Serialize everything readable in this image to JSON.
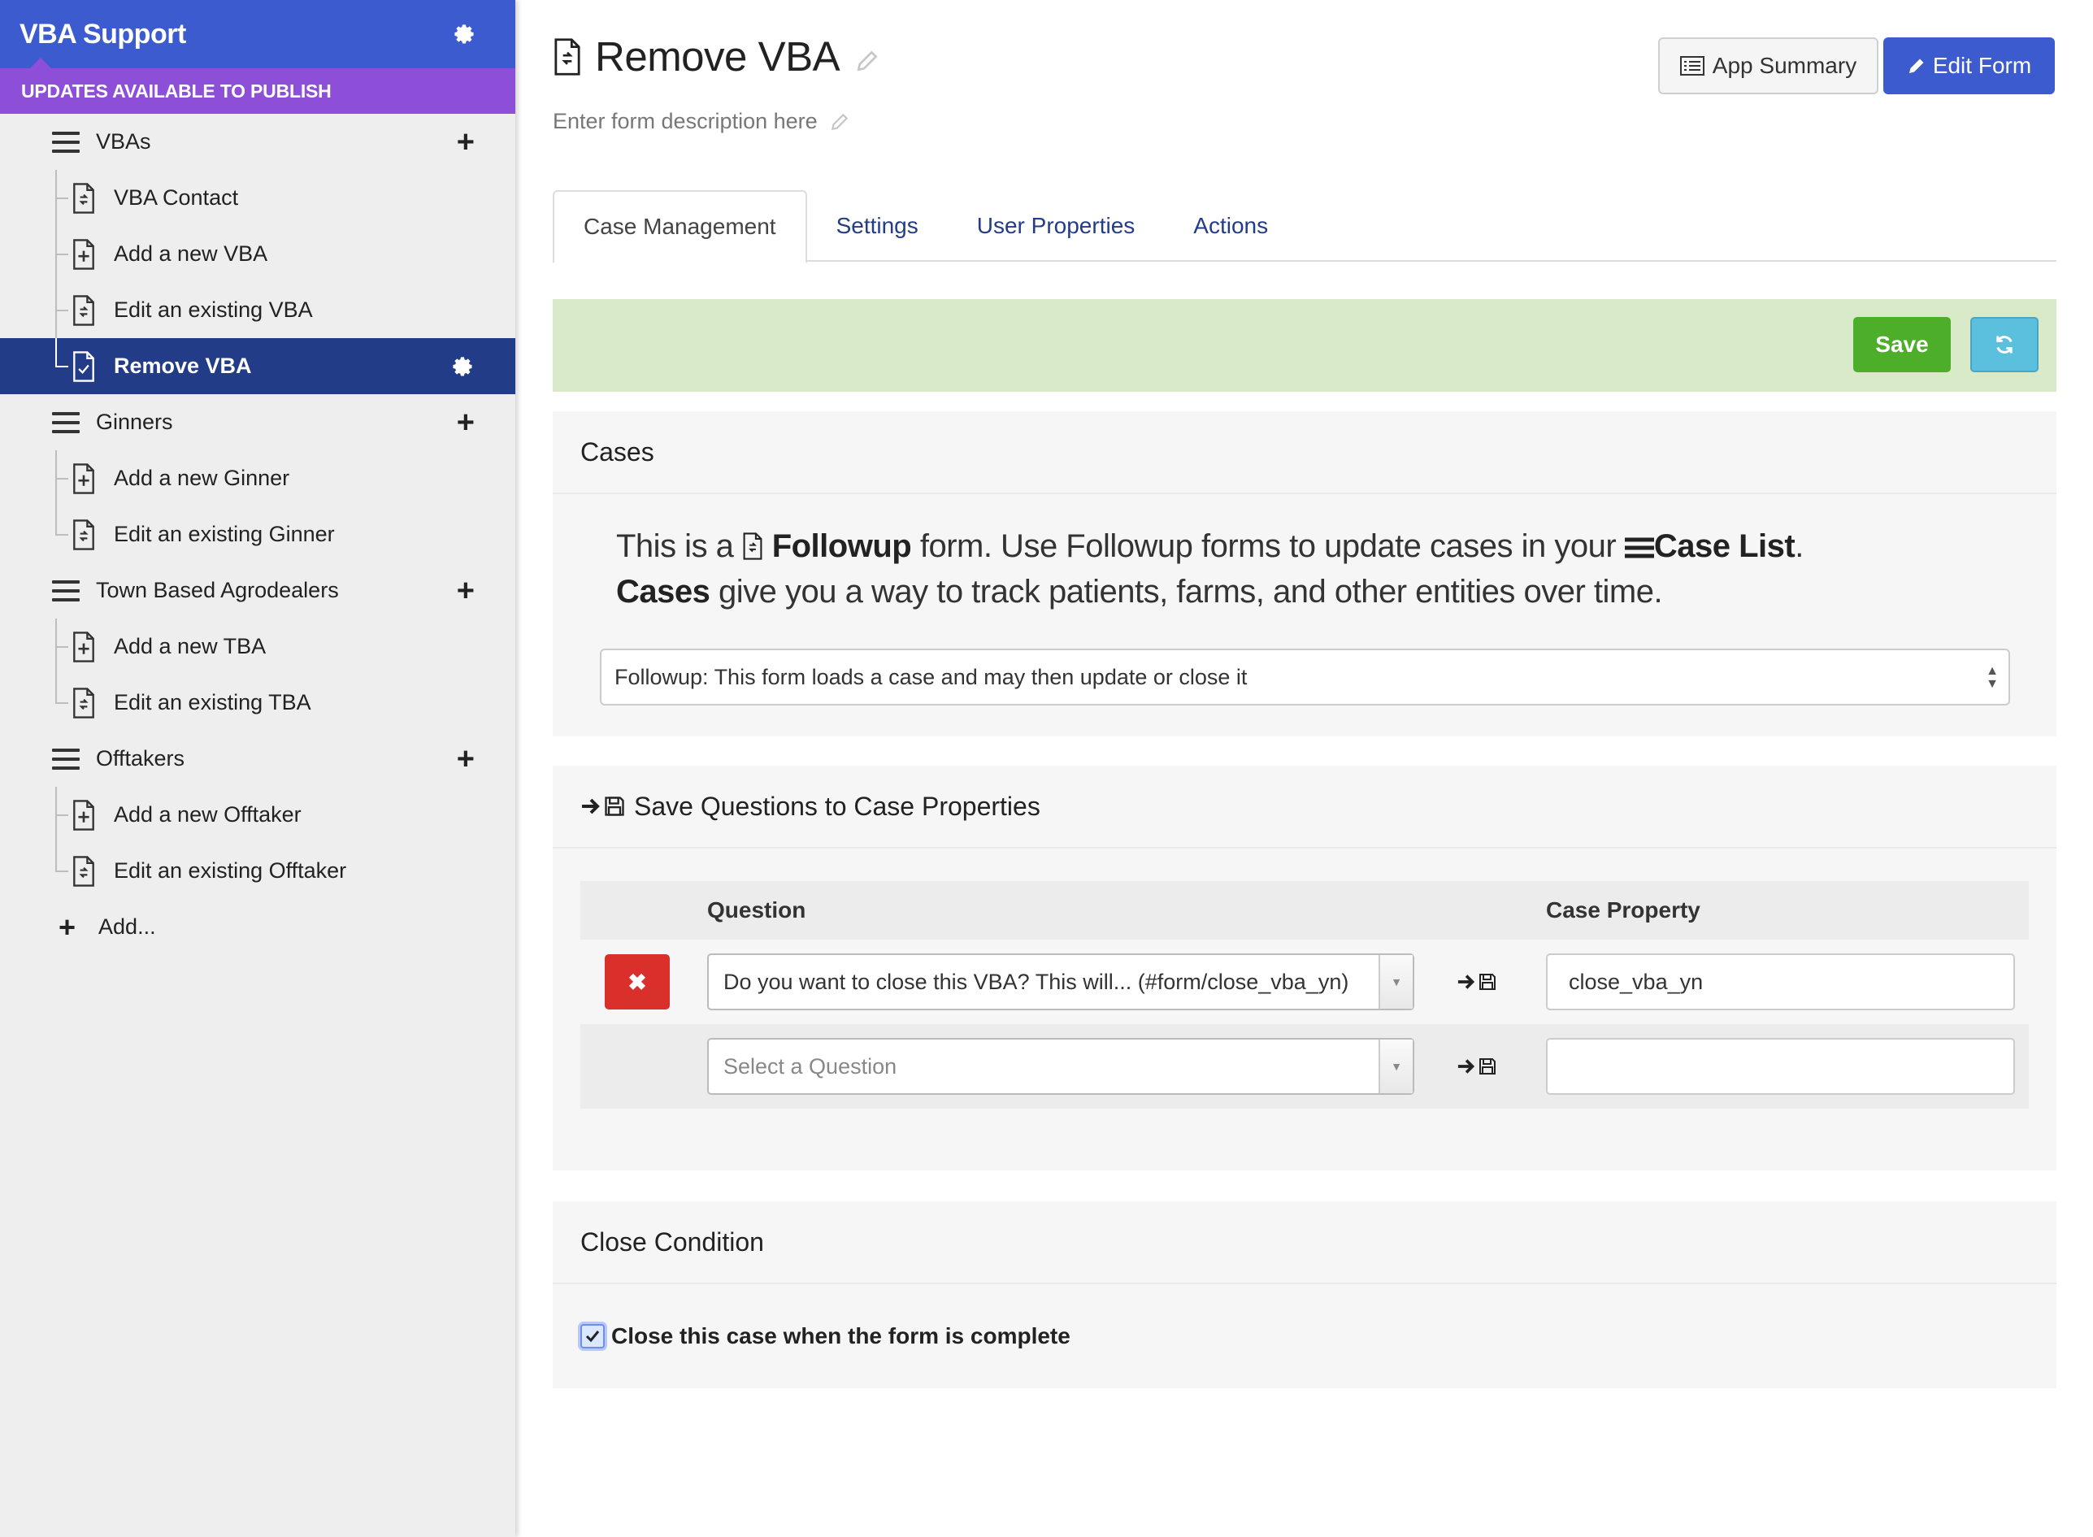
{
  "app": {
    "title": "VBA Support",
    "updates_banner": "UPDATES AVAILABLE TO PUBLISH"
  },
  "sidebar": {
    "modules": [
      {
        "label": "VBAs",
        "forms": [
          "VBA Contact",
          "Add a new VBA",
          "Edit an existing VBA",
          "Remove VBA"
        ]
      },
      {
        "label": "Ginners",
        "forms": [
          "Add a new Ginner",
          "Edit an existing Ginner"
        ]
      },
      {
        "label": "Town Based Agrodealers",
        "forms": [
          "Add a new TBA",
          "Edit an existing TBA"
        ]
      },
      {
        "label": "Offtakers",
        "forms": [
          "Add a new Offtaker",
          "Edit an existing Offtaker"
        ]
      }
    ],
    "add_label": "Add...",
    "active_form": "Remove VBA"
  },
  "header": {
    "title": "Remove VBA",
    "description_placeholder": "Enter form description here",
    "app_summary_label": "App Summary",
    "edit_form_label": "Edit Form"
  },
  "tabs": [
    "Case Management",
    "Settings",
    "User Properties",
    "Actions"
  ],
  "save_bar": {
    "save_label": "Save"
  },
  "cases_panel": {
    "title": "Cases",
    "line1_a": "This is a",
    "line1_b": "Followup",
    "line1_c": "form. Use Followup forms to update cases in your",
    "line1_d": "Case List",
    "line1_e": ".",
    "line2_a": "Cases",
    "line2_b": "give you a way to track patients, farms, and other entities over time.",
    "form_type_selected": "Followup: This form loads a case and may then update or close it"
  },
  "save_panel": {
    "title": "Save Questions to Case Properties",
    "col_question": "Question",
    "col_property": "Case Property",
    "rows": [
      {
        "question": "Do you want to close this VBA? This will... (#form/close_vba_yn)",
        "property": "close_vba_yn"
      },
      {
        "question_placeholder": "Select a Question",
        "property": ""
      }
    ]
  },
  "close_panel": {
    "title": "Close Condition",
    "checkbox_label": "Close this case when the form is complete",
    "checked": true
  },
  "colors": {
    "brand_blue": "#3b5bcf",
    "purple": "#8e4fd8",
    "active_nav": "#233c87",
    "save_green": "#4cae29",
    "danger_red": "#d9302c"
  }
}
